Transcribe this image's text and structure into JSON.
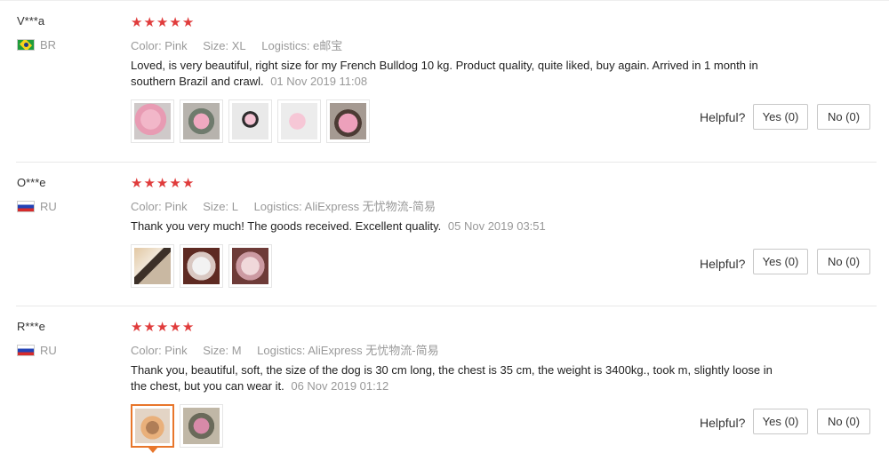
{
  "reviews": [
    {
      "user": "V***a",
      "country": "BR",
      "flag": "brazil-flag-icon",
      "stars": 5,
      "color": "Color: Pink",
      "size": "Size: XL",
      "logistics": "Logistics: e邮宝",
      "text": "Loved, is very beautiful, right size for my French Bulldog 10 kg. Product quality, quite liked, buy again. Arrived in 1 month in southern Brazil and crawl.",
      "date": "01 Nov 2019 11:08",
      "photo_count": 5,
      "helpful_label": "Helpful?",
      "yes_label": "Yes (0)",
      "no_label": "No (0)"
    },
    {
      "user": "O***e",
      "country": "RU",
      "flag": "russia-flag-icon",
      "stars": 5,
      "color": "Color: Pink",
      "size": "Size: L",
      "logistics": "Logistics: AliExpress 无忧物流-简易",
      "text": "Thank you very much! The goods received. Excellent quality.",
      "date": "05 Nov 2019 03:51",
      "photo_count": 3,
      "helpful_label": "Helpful?",
      "yes_label": "Yes (0)",
      "no_label": "No (0)"
    },
    {
      "user": "R***e",
      "country": "RU",
      "flag": "russia-flag-icon",
      "stars": 5,
      "color": "Color: Pink",
      "size": "Size: M",
      "logistics": "Logistics: AliExpress 无忧物流-简易",
      "text": "Thank you, beautiful, soft, the size of the dog is 30 cm long, the chest is 35 cm, the weight is 3400kg., took m, slightly loose in the chest, but you can wear it.",
      "date": "06 Nov 2019 01:12",
      "photo_count": 2,
      "helpful_label": "Helpful?",
      "yes_label": "Yes (0)",
      "no_label": "No (0)"
    }
  ],
  "icons": {
    "star": "star-icon",
    "caret": "selected-caret-icon"
  },
  "colors": {
    "star": "#e03c3c",
    "selected_thumb": "#e8762b",
    "muted_text": "#999999"
  }
}
